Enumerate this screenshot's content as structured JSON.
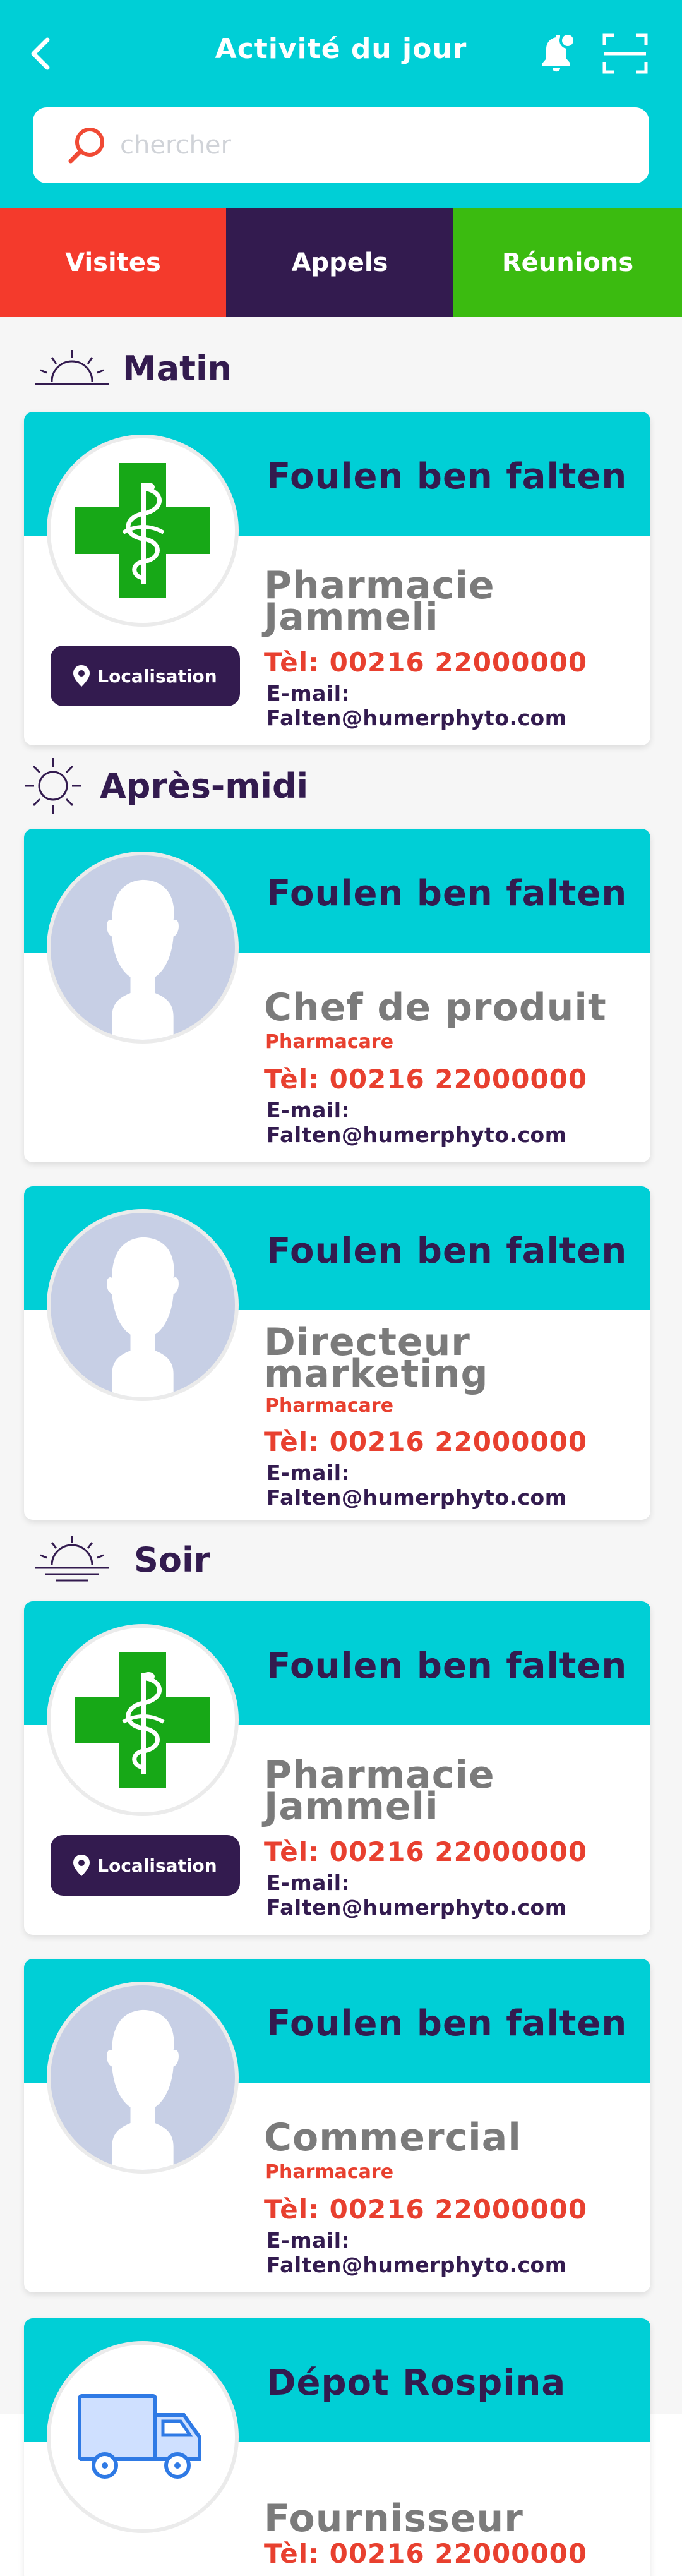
{
  "header": {
    "title": "Activité du jour",
    "back_icon": "chevron-left-icon",
    "bell_icon": "bell-notification-icon",
    "scan_icon": "scan-icon",
    "bg_color": "#00cfd6"
  },
  "search": {
    "placeholder": "chercher",
    "value": ""
  },
  "tabs": [
    {
      "label": "Visites",
      "color": "#f43a2c"
    },
    {
      "label": "Appels",
      "color": "#331b4f",
      "active": true
    },
    {
      "label": "Réunions",
      "color": "#3bbb10"
    }
  ],
  "sections": {
    "matin": "Matin",
    "apres_midi": "Après-midi",
    "soir": "Soir"
  },
  "cards": [
    {
      "name": "Foulen ben falten",
      "role": "Pharmacie Jammeli",
      "subtitle": "",
      "tel": "Tèl: 00216 22000000",
      "email": "E-mail: Falten@humerphyto.com",
      "avatar": "pharmacy-cross-icon",
      "localisation": "Localisation"
    },
    {
      "name": "Foulen ben falten",
      "role": "Chef de produit",
      "subtitle": "Pharmacare",
      "tel": "Tèl: 00216 22000000",
      "email": "E-mail: Falten@humerphyto.com",
      "avatar": "person-silhouette-icon"
    },
    {
      "name": "Foulen ben falten",
      "role": "Directeur marketing",
      "subtitle": "Pharmacare",
      "tel": "Tèl: 00216 22000000",
      "email": "E-mail: Falten@humerphyto.com",
      "avatar": "person-silhouette-icon"
    },
    {
      "name": "Foulen ben falten",
      "role": "Pharmacie Jammeli",
      "subtitle": "",
      "tel": "Tèl: 00216 22000000",
      "email": "E-mail: Falten@humerphyto.com",
      "avatar": "pharmacy-cross-icon",
      "localisation": "Localisation"
    },
    {
      "name": "Foulen ben falten",
      "role": "Commercial",
      "subtitle": "Pharmacare",
      "tel": "Tèl: 00216 22000000",
      "email": "E-mail: Falten@humerphyto.com",
      "avatar": "person-silhouette-icon"
    },
    {
      "name": "Dépot Rospina",
      "role": "Fournisseur",
      "subtitle": "",
      "tel": "Tèl: 00216 22000000",
      "email": "",
      "avatar": "delivery-truck-icon"
    }
  ]
}
